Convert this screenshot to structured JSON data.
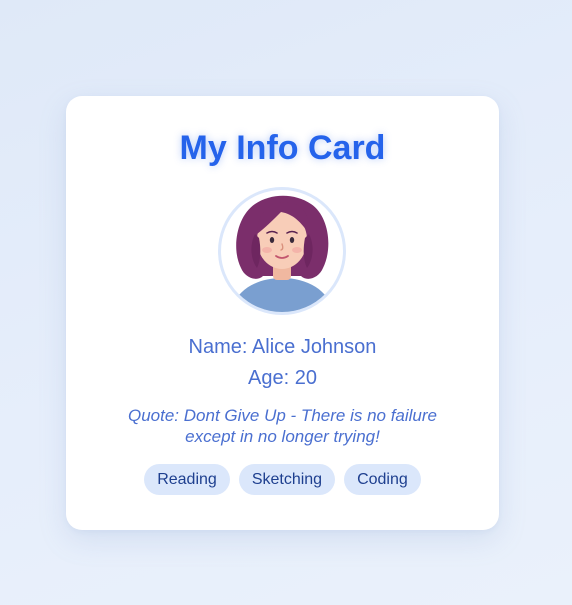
{
  "card": {
    "title": "My Info Card",
    "name_label": "Name:",
    "name": "Alice Johnson",
    "age_label": "Age:",
    "age": "20",
    "quote_label": "Quote:",
    "quote": "Dont Give Up - There is no failure except in no longer trying!",
    "hobbies": [
      "Reading",
      "Sketching",
      "Coding"
    ]
  },
  "colors": {
    "accent": "#2563eb",
    "text": "#4a6fd0",
    "tag_bg": "#dbe7fb",
    "tag_text": "#1e3f8f"
  },
  "icons": {
    "avatar": "avatar-icon"
  }
}
